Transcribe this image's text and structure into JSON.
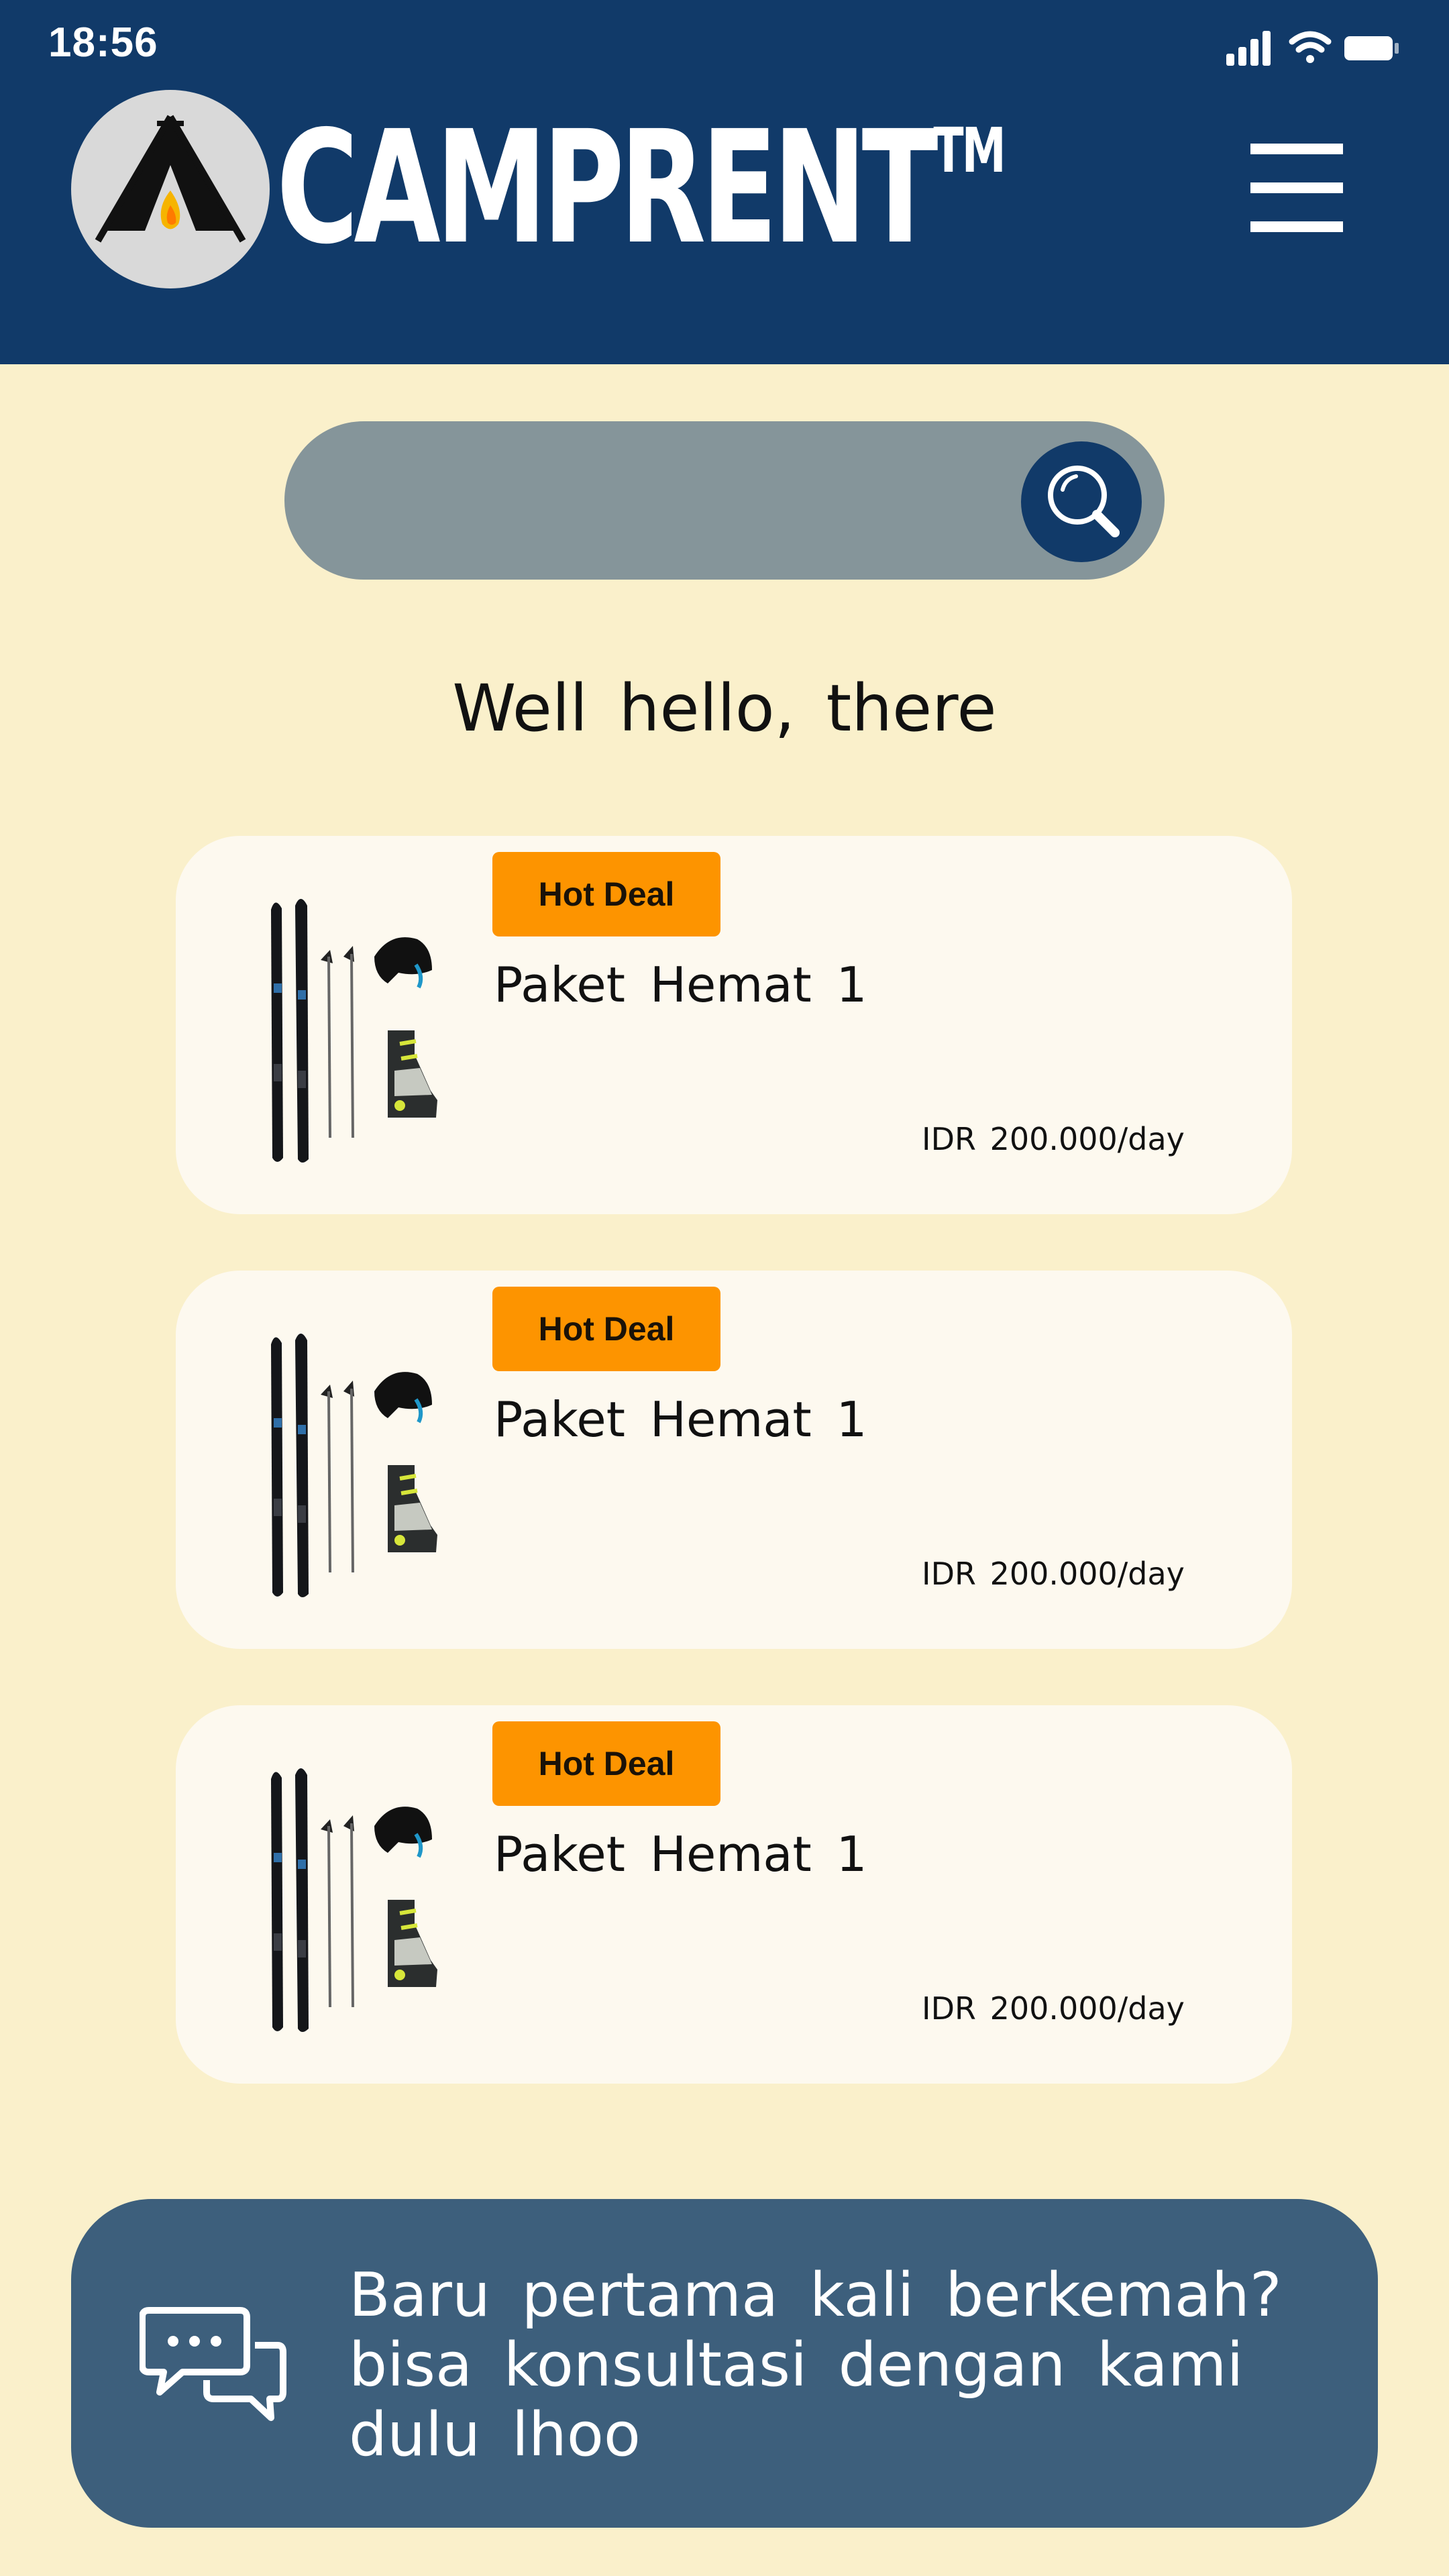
{
  "status_bar": {
    "time": "18:56",
    "icons": [
      "cellular-signal-icon",
      "wifi-icon",
      "battery-icon"
    ]
  },
  "header": {
    "brand": "CAMPRENT",
    "trademark": "TM",
    "logo_icon": "tent-campfire-icon",
    "menu_icon": "hamburger-menu-icon"
  },
  "search": {
    "placeholder": "",
    "icon": "search-icon"
  },
  "greeting": "Well hello, there",
  "cards": [
    {
      "badge": "Hot Deal",
      "title": "Paket Hemat 1",
      "price": "IDR 200.000/day",
      "image": "ski-equipment-set-image"
    },
    {
      "badge": "Hot Deal",
      "title": "Paket Hemat 1",
      "price": "IDR 200.000/day",
      "image": "ski-equipment-set-image"
    },
    {
      "badge": "Hot Deal",
      "title": "Paket Hemat 1",
      "price": "IDR 200.000/day",
      "image": "ski-equipment-set-image"
    }
  ],
  "consult": {
    "icon": "chat-bubbles-icon",
    "line1": "Baru pertama kali berkemah?",
    "line2": "bisa konsultasi dengan kami",
    "line3": "dulu lhoo"
  },
  "colors": {
    "header_bg": "#113a69",
    "page_bg": "#faf0cb",
    "search_bg": "#85959a",
    "card_bg": "#fdf9ef",
    "badge_bg": "#fd9400",
    "consult_bg": "#3d5f7c"
  }
}
